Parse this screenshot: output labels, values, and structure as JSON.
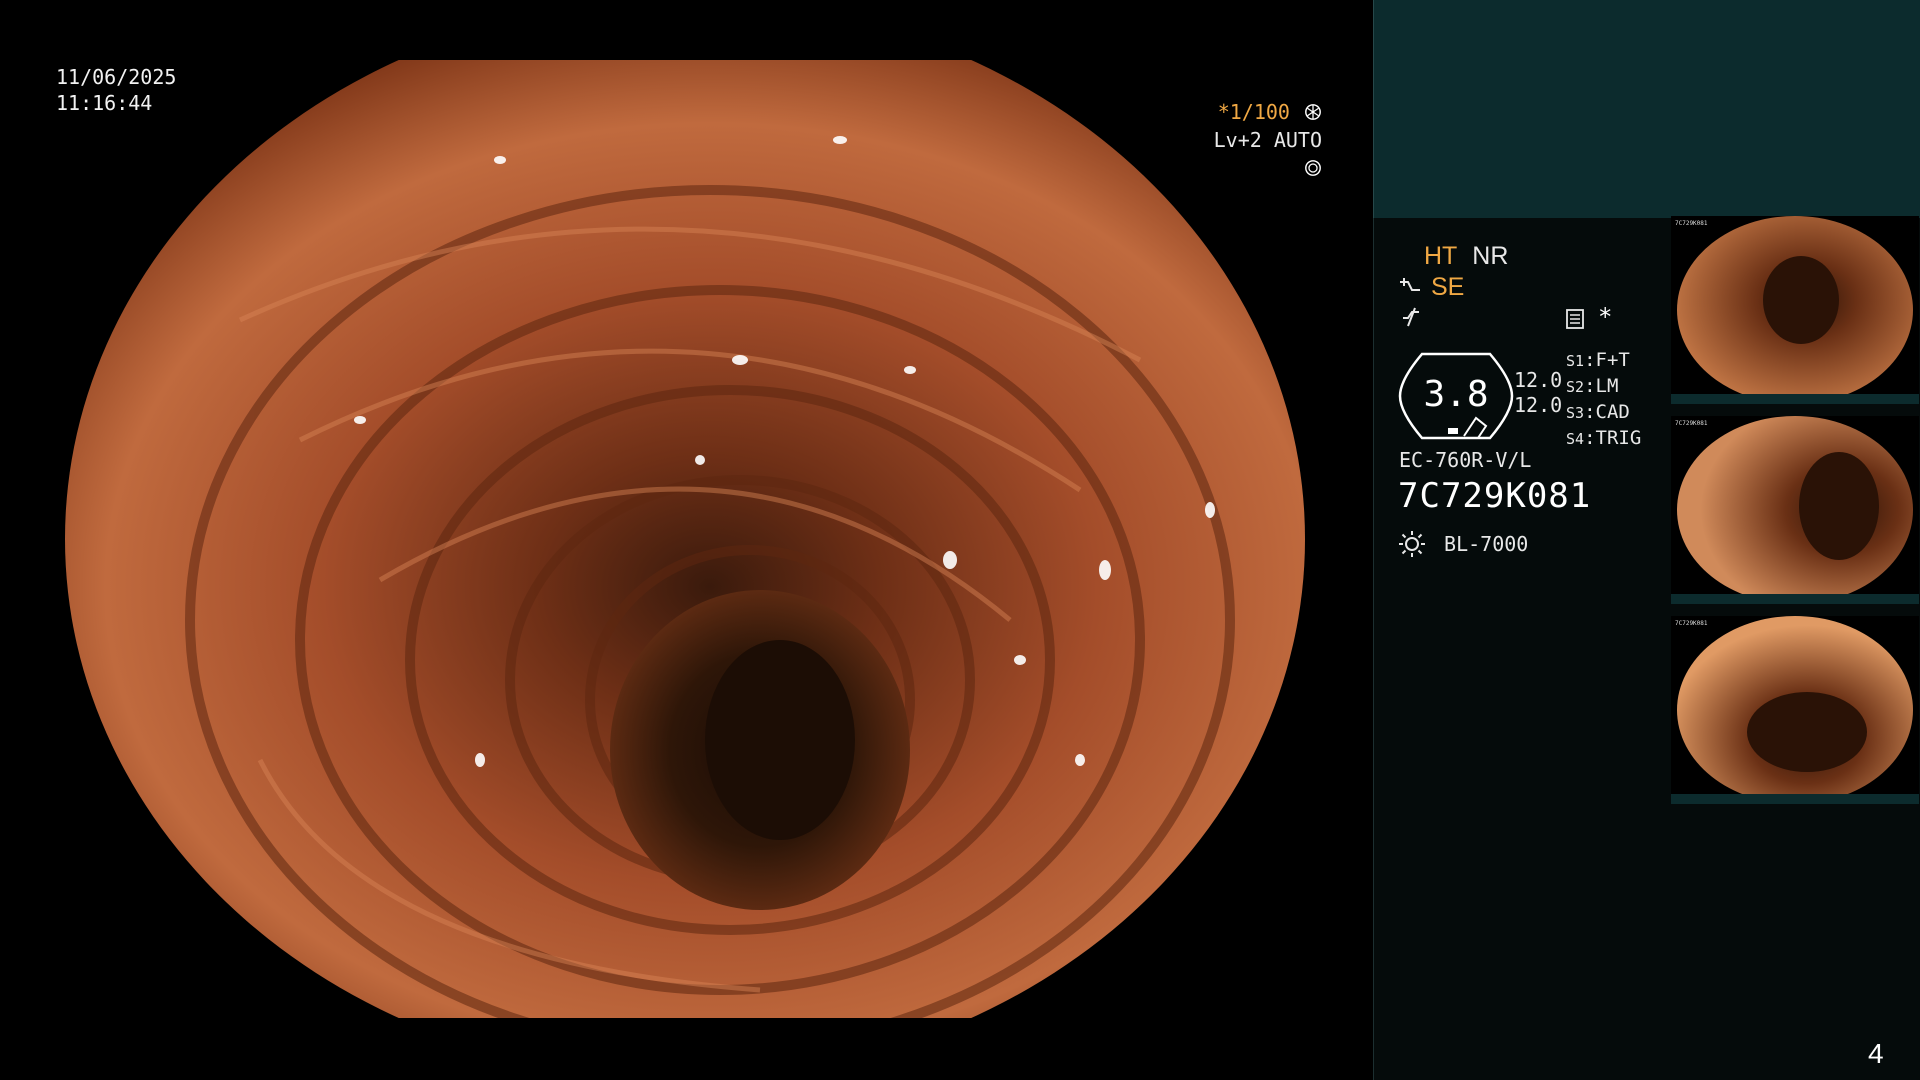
{
  "overlay": {
    "date": "11/06/2025",
    "time": "11:16:44",
    "shutter": "*1/100",
    "level": "Lv+2 AUTO"
  },
  "panel": {
    "mode_ht": "HT",
    "mode_nr": "NR",
    "mode_se": "SE",
    "zoom_value": "3.8",
    "gain_1": "12.0",
    "gain_2": "12.0",
    "switches": [
      {
        "key": "S1",
        "value": "F+T"
      },
      {
        "key": "S2",
        "value": "LM"
      },
      {
        "key": "S3",
        "value": "CAD"
      },
      {
        "key": "S4",
        "value": "TRIG"
      }
    ],
    "scope_model": "EC-760R-V/L",
    "scope_serial": "7C729K081",
    "light_source": "BL-7000",
    "icons": {
      "shutter": "aperture-icon",
      "auto": "auto-iris-icon",
      "se": "edge-enhance-icon",
      "filter": "filter-icon",
      "memo": "memo-icon",
      "light": "light-source-icon"
    }
  },
  "thumbnails": [
    {
      "serial": "7C729K081"
    },
    {
      "serial": "7C729K081"
    },
    {
      "serial": "7C729K081"
    }
  ],
  "page_number": "4",
  "colors": {
    "panel_top": "#0c2b2d",
    "panel_bg": "#050b0b",
    "accent_orange": "#f0a844"
  }
}
